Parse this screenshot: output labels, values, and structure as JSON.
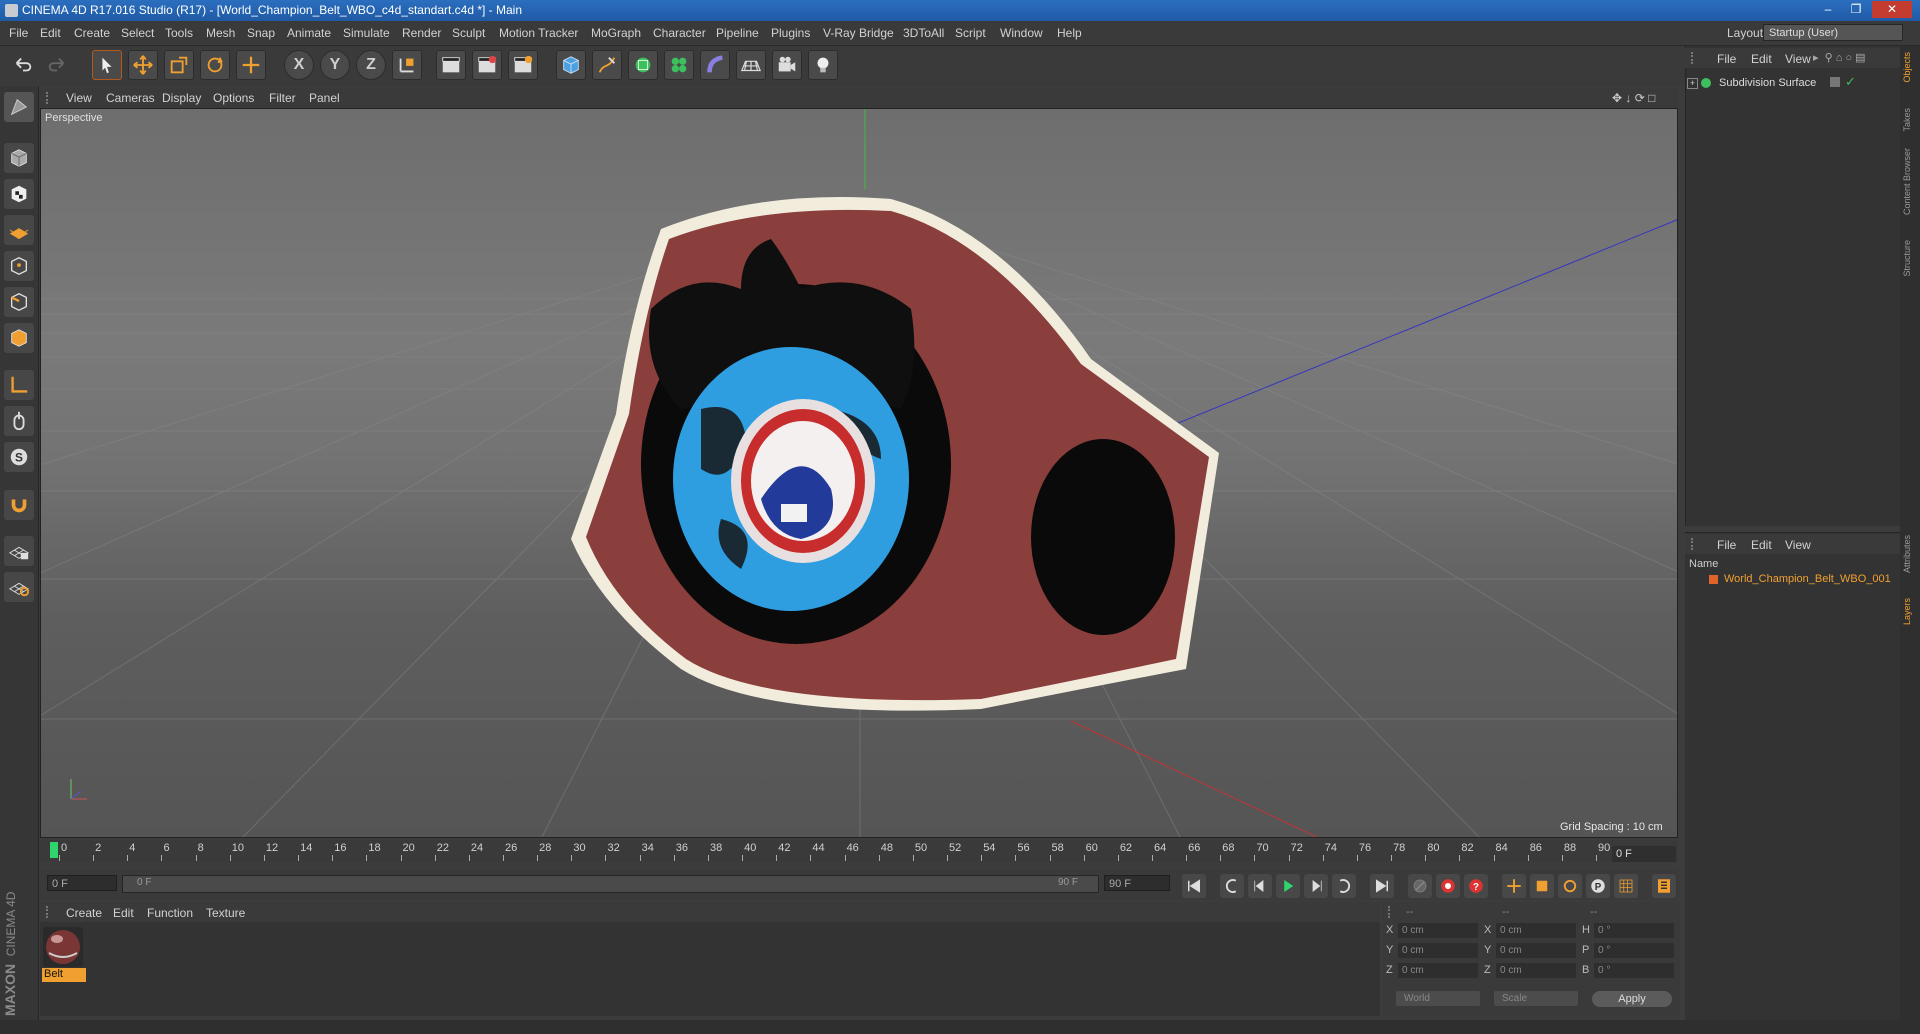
{
  "window": {
    "title": "CINEMA 4D R17.016 Studio (R17) - [World_Champion_Belt_WBO_c4d_standart.c4d *] - Main"
  },
  "menubar": {
    "items": [
      "File",
      "Edit",
      "Create",
      "Select",
      "Tools",
      "Mesh",
      "Snap",
      "Animate",
      "Simulate",
      "Render",
      "Sculpt",
      "Motion Tracker",
      "MoGraph",
      "Character",
      "Pipeline",
      "Plugins",
      "V-Ray Bridge",
      "3DToAll",
      "Script",
      "Window",
      "Help"
    ],
    "layout_label": "Layout:",
    "layout_value": "Startup (User)"
  },
  "toolbar": {
    "axis_x": "X",
    "axis_y": "Y",
    "axis_z": "Z"
  },
  "viewport": {
    "menu": [
      "View",
      "Cameras",
      "Display",
      "Options",
      "Filter",
      "Panel"
    ],
    "camera_label": "Perspective",
    "grid_spacing": "Grid Spacing : 10 cm"
  },
  "timeline": {
    "ticks": [
      "0",
      "2",
      "4",
      "6",
      "8",
      "10",
      "12",
      "14",
      "16",
      "18",
      "20",
      "22",
      "24",
      "26",
      "28",
      "30",
      "32",
      "34",
      "36",
      "38",
      "40",
      "42",
      "44",
      "46",
      "48",
      "50",
      "52",
      "54",
      "56",
      "58",
      "60",
      "62",
      "64",
      "66",
      "68",
      "70",
      "72",
      "74",
      "76",
      "78",
      "80",
      "82",
      "84",
      "86",
      "88",
      "90"
    ],
    "current_frame": "0 F",
    "start_field": "0 F",
    "range_start": "0 F",
    "range_end": "90 F",
    "end_field": "90 F"
  },
  "material_manager": {
    "menu": [
      "Create",
      "Edit",
      "Function",
      "Texture"
    ],
    "material_name": "Belt"
  },
  "branding": {
    "maxon": "MAXON",
    "cinema": "CINEMA 4D"
  },
  "coordinates": {
    "header": [
      "--",
      "--",
      "--"
    ],
    "rows": [
      {
        "a": "X",
        "av": "0 cm",
        "b": "X",
        "bv": "0 cm",
        "c": "H",
        "cv": "0 °"
      },
      {
        "a": "Y",
        "av": "0 cm",
        "b": "Y",
        "bv": "0 cm",
        "c": "P",
        "cv": "0 °"
      },
      {
        "a": "Z",
        "av": "0 cm",
        "b": "Z",
        "bv": "0 cm",
        "c": "B",
        "cv": "0 °"
      }
    ],
    "mode": "World",
    "transform": "Scale",
    "apply": "Apply"
  },
  "object_manager": {
    "menu": [
      "File",
      "Edit",
      "View"
    ],
    "object": "Subdivision Surface"
  },
  "layer_manager": {
    "menu": [
      "File",
      "Edit",
      "View"
    ],
    "column_name": "Name",
    "layer": "World_Champion_Belt_WBO_001"
  },
  "right_tabs": [
    "Objects",
    "Takes",
    "Content Browser",
    "Structure",
    "Attributes",
    "Layers"
  ],
  "colors": {
    "accent_orange": "#f0a030",
    "belt_red": "#8a3f3d",
    "title_blue": "#2b6fbf"
  }
}
